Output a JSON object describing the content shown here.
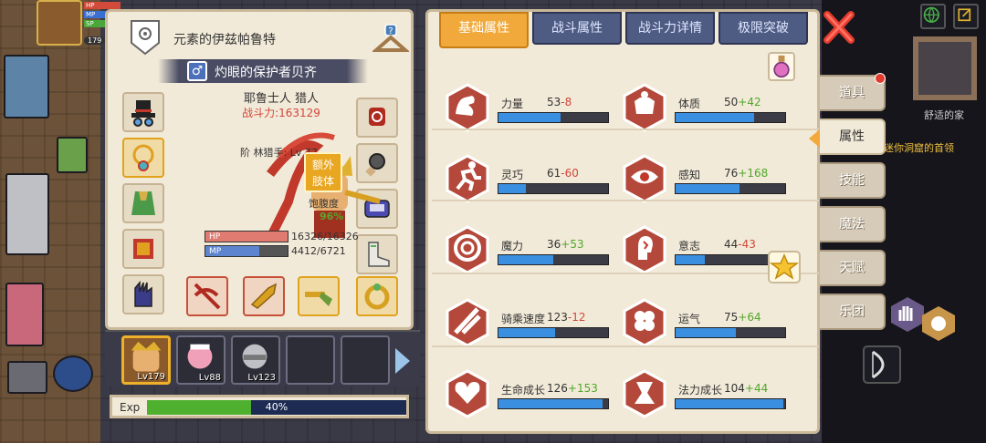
{
  "hud": {
    "player_level": "179",
    "bar_labels": [
      "HP",
      "MP",
      "SP"
    ]
  },
  "character": {
    "title": "元素的伊兹帕鲁特",
    "gender_symbol": "♂",
    "name": "灼眼的保护者贝齐",
    "class_line": "耶鲁士人 猎人",
    "power_line": "战斗力:163129",
    "sub_class": "阶 林猎手: Lv 77",
    "extra_limb_label": "额外\n肢体",
    "satiety_label": "饱腹度",
    "satiety_value": "96%",
    "hp": {
      "label": "HP",
      "value": "16326/16326",
      "fill": 1.0
    },
    "mp": {
      "label": "MP",
      "value": "4412/6721",
      "fill": 0.66
    }
  },
  "pets": [
    {
      "level": "Lv179",
      "active": true
    },
    {
      "level": "Lv88",
      "active": false
    },
    {
      "level": "Lv123",
      "active": false
    },
    {
      "level": "",
      "active": false
    },
    {
      "level": "",
      "active": false
    }
  ],
  "exp": {
    "label": "Exp",
    "percent_text": "40%",
    "fill": 0.4
  },
  "tabs": [
    "基础属性",
    "战斗属性",
    "战斗力详情",
    "极限突破"
  ],
  "attributes": [
    {
      "name": "力量",
      "base": "53",
      "mod": "-8",
      "mod_type": "down",
      "fill": 0.57,
      "icon": "strength-arm-icon"
    },
    {
      "name": "体质",
      "base": "50",
      "mod": "+42",
      "mod_type": "up",
      "fill": 0.72,
      "icon": "constitution-body-icon"
    },
    {
      "name": "灵巧",
      "base": "61",
      "mod": "-60",
      "mod_type": "down",
      "fill": 0.25,
      "icon": "agility-runner-icon"
    },
    {
      "name": "感知",
      "base": "76",
      "mod": "+168",
      "mod_type": "up",
      "fill": 0.58,
      "icon": "perception-eye-icon"
    },
    {
      "name": "魔力",
      "base": "36",
      "mod": "+53",
      "mod_type": "up",
      "fill": 0.5,
      "icon": "magic-spiral-icon"
    },
    {
      "name": "意志",
      "base": "44",
      "mod": "-43",
      "mod_type": "down",
      "fill": 0.27,
      "icon": "will-head-icon"
    },
    {
      "name": "骑乘速度",
      "base": "123",
      "mod": "-12",
      "mod_type": "down",
      "fill": 0.52,
      "icon": "riding-speed-icon"
    },
    {
      "name": "运气",
      "base": "75",
      "mod": "+64",
      "mod_type": "up",
      "fill": 0.55,
      "icon": "luck-clover-icon"
    },
    {
      "name": "生命成长",
      "base": "126",
      "mod": "+153",
      "mod_type": "up",
      "fill": 0.95,
      "icon": "life-growth-heart-icon"
    },
    {
      "name": "法力成长",
      "base": "104",
      "mod": "+44",
      "mod_type": "up",
      "fill": 0.98,
      "icon": "mana-growth-icon"
    }
  ],
  "side_menu": [
    "道具",
    "属性",
    "技能",
    "魔法",
    "天赋",
    "乐团"
  ],
  "minimap": {
    "label": "舒适的家"
  },
  "quest_text": "迷你洞窟的首领",
  "colors": {
    "accent": "#f0a93a",
    "tab": "#4e5b82",
    "bar_blue": "#3b8fe0",
    "up": "#4fa72a",
    "down": "#d2463a",
    "badge_red": "#c0392b"
  }
}
